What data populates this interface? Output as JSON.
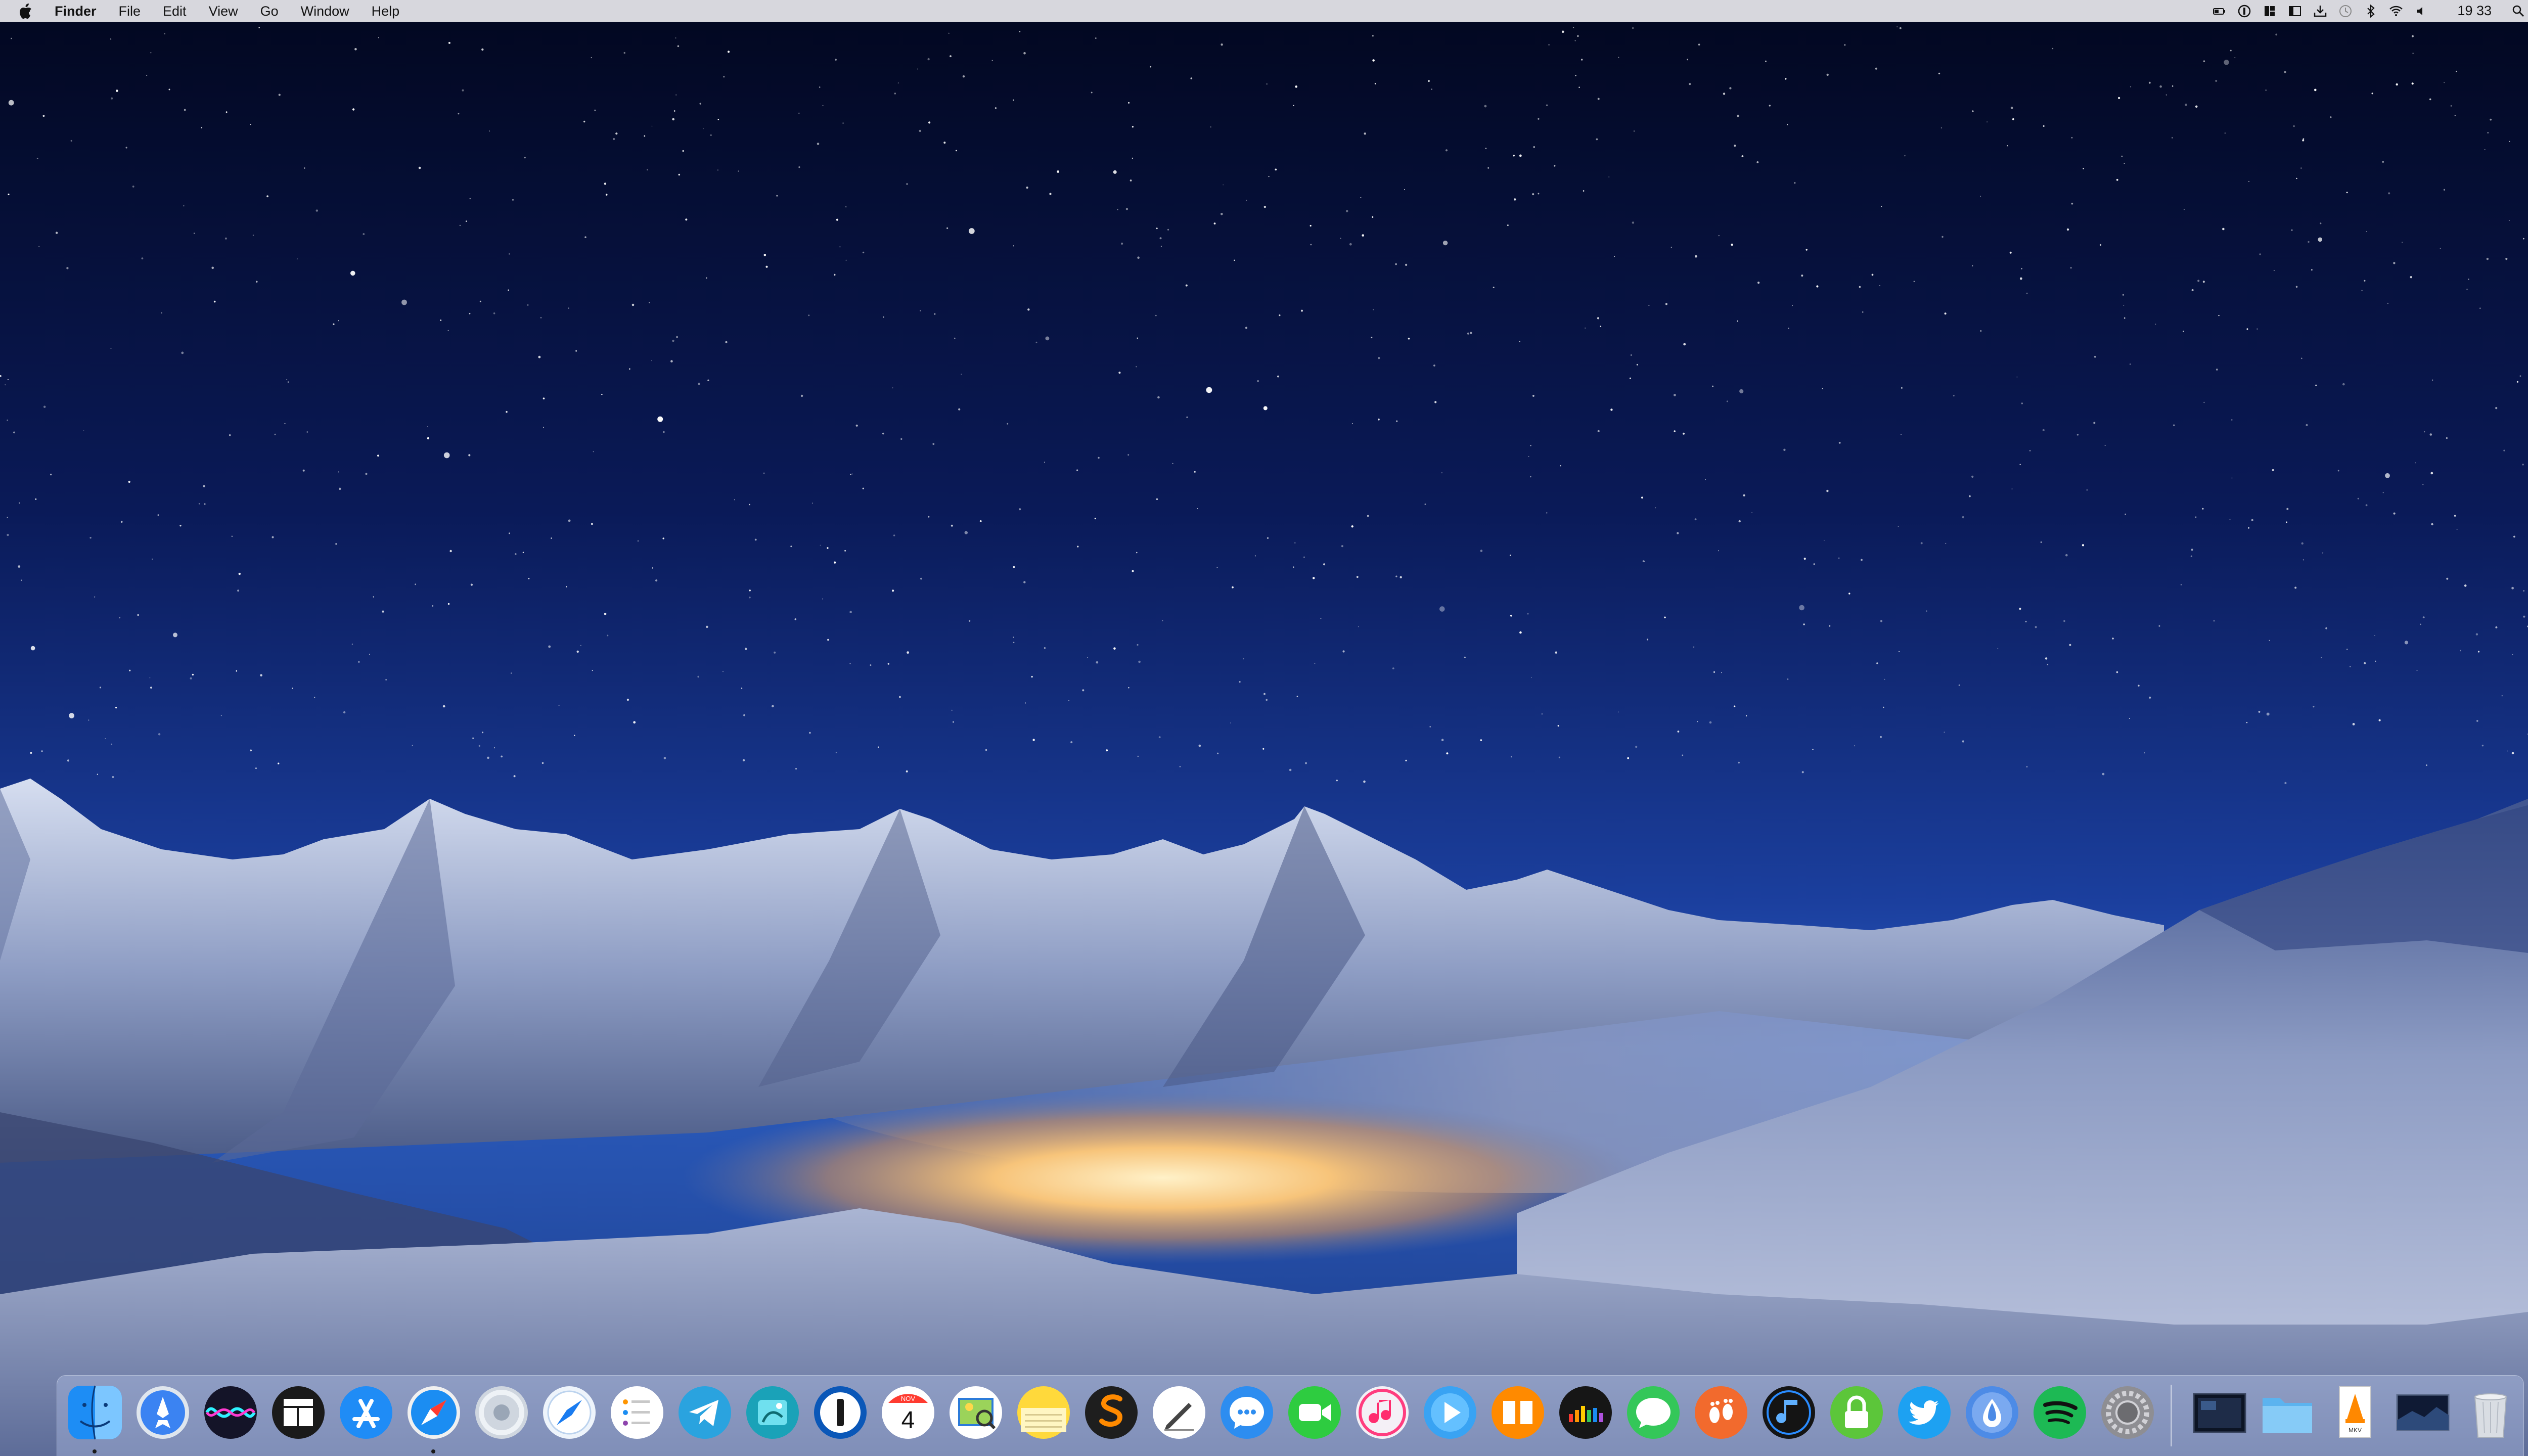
{
  "menubar": {
    "app_name": "Finder",
    "menus": [
      "File",
      "Edit",
      "View",
      "Go",
      "Window",
      "Help"
    ],
    "clock": "19 33"
  },
  "dock": {
    "apps": [
      "finder",
      "launchpad",
      "siri",
      "window-manager",
      "app-store",
      "safari",
      "chrome",
      "compass",
      "reminders",
      "telegram",
      "xcode-like",
      "1password",
      "calendar",
      "preview",
      "notes",
      "sublime-text",
      "script-editor",
      "messenger",
      "facetime",
      "itunes",
      "infuse",
      "books",
      "equalizer",
      "messages",
      "bigfoot",
      "music-player",
      "vpn",
      "twitter",
      "tor-browser",
      "spotify",
      "system-preferences"
    ],
    "calendar": {
      "month": "NOV",
      "day": "4"
    },
    "finder_running": true,
    "safari_running": true,
    "stacks": [
      "screenshot-stack",
      "folder-stack",
      "mkv-file",
      "desktop-thumb",
      "trash"
    ],
    "mkv_label": "MKV",
    "colors": {
      "spotify": "#1db954",
      "messages": "#34c759",
      "facetime": "#2ecc40",
      "telegram": "#2aa3df",
      "twitter": "#1da1f2",
      "books": "#ff8a00"
    }
  }
}
